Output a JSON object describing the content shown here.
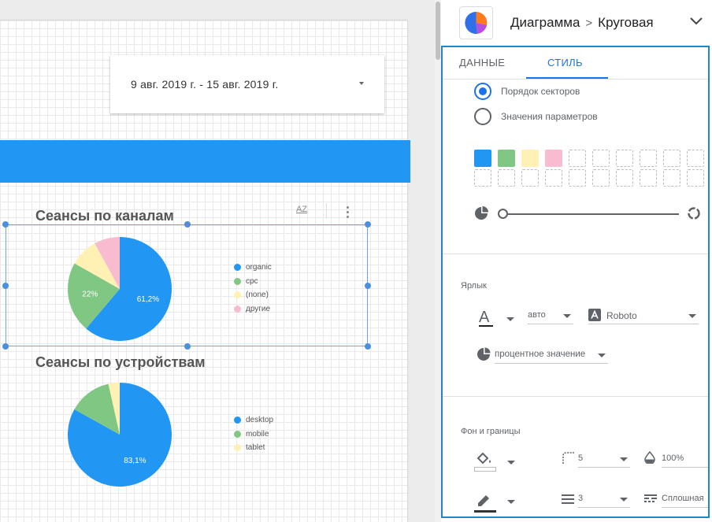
{
  "report": {
    "date_range": "9 авг. 2019 г. - 15 авг. 2019 г.",
    "charts": [
      {
        "title": "Сеансы по каналам",
        "legend": [
          {
            "label": "organic",
            "color": "#2196f3"
          },
          {
            "label": "cpc",
            "color": "#81c784"
          },
          {
            "label": "(none)",
            "color": "#fff0b3"
          },
          {
            "label": "другие",
            "color": "#f8bbd0"
          }
        ],
        "slice_labels": [
          "61,2%",
          "22%"
        ]
      },
      {
        "title": "Сеансы по устройствам",
        "legend": [
          {
            "label": "desktop",
            "color": "#2196f3"
          },
          {
            "label": "mobile",
            "color": "#81c784"
          },
          {
            "label": "tablet",
            "color": "#fff0b3"
          }
        ],
        "slice_labels": [
          "83,1%"
        ]
      }
    ],
    "toolbar": {
      "sort_label": "AZ"
    }
  },
  "chart_data": [
    {
      "type": "pie",
      "title": "Сеансы по каналам",
      "categories": [
        "organic",
        "cpc",
        "(none)",
        "другие"
      ],
      "values": [
        61.2,
        22.0,
        8.8,
        8.0
      ],
      "unit": "%"
    },
    {
      "type": "pie",
      "title": "Сеансы по устройствам",
      "categories": [
        "desktop",
        "mobile",
        "tablet"
      ],
      "values": [
        83.1,
        13.4,
        3.5
      ],
      "unit": "%"
    }
  ],
  "panel": {
    "breadcrumb_root": "Диаграмма",
    "breadcrumb_separator": ">",
    "breadcrumb_leaf": "Круговая",
    "tabs": {
      "data": "ДАННЫЕ",
      "style": "СТИЛЬ"
    },
    "active_tab": "СТИЛЬ",
    "radio_options": [
      {
        "label": "Порядок секторов",
        "selected": true
      },
      {
        "label": "Значения параметров",
        "selected": false
      }
    ],
    "palette": [
      "#2196f3",
      "#81c784",
      "#fff0b3",
      "#f8bbd0"
    ],
    "label_section": {
      "title": "Ярлык",
      "font_size": "авто",
      "font_family": "Roboto",
      "label_type": "процентное значение"
    },
    "background_section": {
      "title": "Фон и границы",
      "border_radius": "5",
      "opacity": "100%",
      "border_weight": "3",
      "border_style": "Сплошная"
    }
  }
}
